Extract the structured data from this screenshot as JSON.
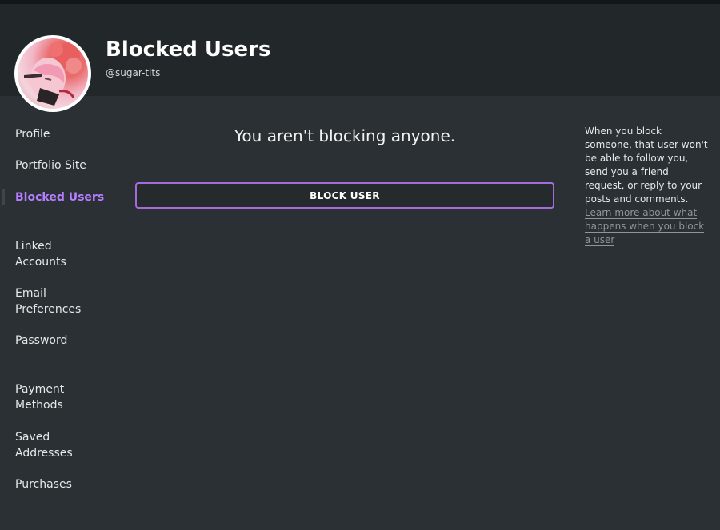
{
  "header": {
    "title": "Blocked Users",
    "handle": "@sugar-tits"
  },
  "sidebar": {
    "items": [
      {
        "label": "Profile",
        "active": false
      },
      {
        "label": "Portfolio Site",
        "active": false
      },
      {
        "label": "Blocked Users",
        "active": true
      },
      {
        "label": "Linked\nAccounts",
        "active": false
      },
      {
        "label": "Email\nPreferences",
        "active": false
      },
      {
        "label": "Password",
        "active": false
      },
      {
        "label": "Payment\nMethods",
        "active": false
      },
      {
        "label": "Saved\nAddresses",
        "active": false
      },
      {
        "label": "Purchases",
        "active": false
      }
    ]
  },
  "main": {
    "empty_message": "You aren't blocking anyone.",
    "block_button_label": "BLOCK USER"
  },
  "info": {
    "text": "When you block someone, that user won't be able to follow you, send you a friend request, or reply to your posts and comments.",
    "link_text": "Learn more about what happens when you block a user"
  },
  "colors": {
    "accent": "#b67fff",
    "button_border": "#a56bdc",
    "background": "#2a3033",
    "header_background": "#222829"
  }
}
